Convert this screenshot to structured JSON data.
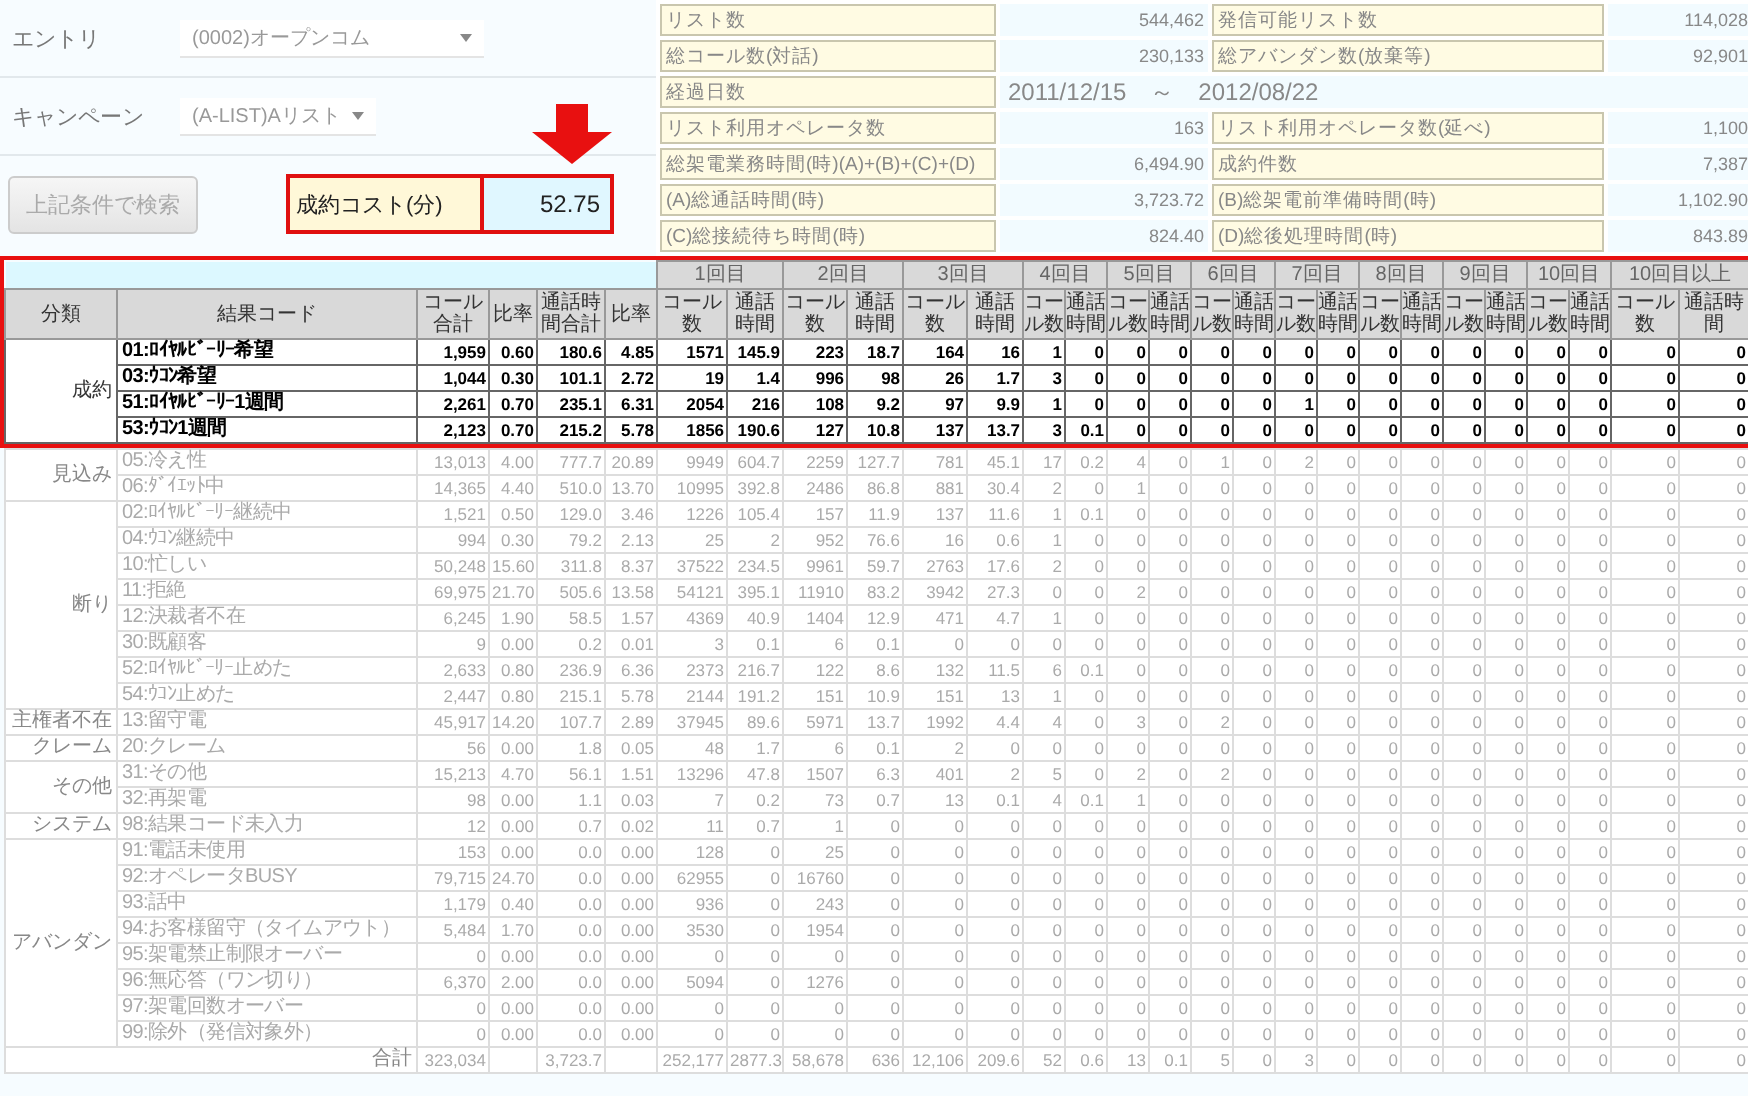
{
  "form": {
    "fields": [
      {
        "label": "エントリ",
        "value": "(0002)オープンコム"
      },
      {
        "label": "キャンペーン",
        "value": "(A-LIST)Aリスト"
      }
    ],
    "search_button": {
      "label": "上記条件で検索",
      "disabled": true
    }
  },
  "cost": {
    "label": "成約コスト(分)",
    "value": "52.75"
  },
  "stats": [
    {
      "cells": [
        {
          "label": "リスト数",
          "value": "544,462"
        },
        {
          "label": "発信可能リスト数",
          "value": "114,028"
        }
      ]
    },
    {
      "cells": [
        {
          "label": "総コール数(対話)",
          "value": "230,133"
        },
        {
          "label": "総アバンダン数(放棄等)",
          "value": "92,901"
        }
      ]
    },
    {
      "cells": [
        {
          "label": "経過日数",
          "value": "2011/12/15　～　2012/08/22"
        }
      ]
    },
    {
      "cells": [
        {
          "label": "リスト利用オペレータ数",
          "value": "163"
        },
        {
          "label": "リスト利用オペレータ数(延べ)",
          "value": "1,100"
        }
      ]
    },
    {
      "cells": [
        {
          "label": "総架電業務時間(時)(A)+(B)+(C)+(D)",
          "value": "6,494.90"
        },
        {
          "label": "成約件数",
          "value": "7,387"
        }
      ]
    },
    {
      "cells": [
        {
          "label": "(A)総通話時間(時)",
          "value": "3,723.72"
        },
        {
          "label": "(B)総架電前準備時間(時)",
          "value": "1,102.90"
        }
      ]
    },
    {
      "cells": [
        {
          "label": "(C)総接続待ち時間(時)",
          "value": "824.40"
        },
        {
          "label": "(D)総後処理時間(時)",
          "value": "843.89"
        }
      ]
    }
  ],
  "table": {
    "columns": [
      "分類",
      "結果コード",
      "コール合計",
      "比率",
      "通話時間合計",
      "比率"
    ],
    "rounds": [
      {
        "label": "1回目",
        "columns": [
          "コール数",
          "通話時間"
        ]
      },
      {
        "label": "2回目",
        "columns": [
          "コール数",
          "通話時間"
        ]
      },
      {
        "label": "3回目",
        "columns": [
          "コール数",
          "通話時間"
        ]
      },
      {
        "label": "4回目",
        "columns": [
          "コール数",
          "通話時間"
        ]
      },
      {
        "label": "5回目",
        "columns": [
          "コール数",
          "通話時間"
        ]
      },
      {
        "label": "6回目",
        "columns": [
          "コール数",
          "通話時間"
        ]
      },
      {
        "label": "7回目",
        "columns": [
          "コール数",
          "通話時間"
        ]
      },
      {
        "label": "8回目",
        "columns": [
          "コール数",
          "通話時間"
        ]
      },
      {
        "label": "9回目",
        "columns": [
          "コール数",
          "通話時間"
        ]
      },
      {
        "label": "10回目",
        "columns": [
          "コール数",
          "通話時間"
        ]
      },
      {
        "label": "10回目以上",
        "columns": [
          "コール数",
          "通話時間"
        ]
      }
    ],
    "groups": [
      {
        "label": "成約",
        "emphasized": true,
        "rows": [
          {
            "code": "01:ﾛｲﾔﾙﾋﾞｰﾘｰ希望",
            "cells": [
              "1,959",
              "0.60",
              "180.6",
              "4.85",
              "1571",
              "145.9",
              "223",
              "18.7",
              "164",
              "16",
              "1",
              "0",
              "0",
              "0",
              "0",
              "0",
              "0",
              "0",
              "0",
              "0",
              "0",
              "0",
              "0",
              "0",
              "0",
              "0"
            ]
          },
          {
            "code": "03:ｳｺﾝ希望",
            "cells": [
              "1,044",
              "0.30",
              "101.1",
              "2.72",
              "19",
              "1.4",
              "996",
              "98",
              "26",
              "1.7",
              "3",
              "0",
              "0",
              "0",
              "0",
              "0",
              "0",
              "0",
              "0",
              "0",
              "0",
              "0",
              "0",
              "0",
              "0",
              "0"
            ]
          },
          {
            "code": "51:ﾛｲﾔﾙﾋﾞｰﾘｰ1週間",
            "cells": [
              "2,261",
              "0.70",
              "235.1",
              "6.31",
              "2054",
              "216",
              "108",
              "9.2",
              "97",
              "9.9",
              "1",
              "0",
              "0",
              "0",
              "0",
              "0",
              "1",
              "0",
              "0",
              "0",
              "0",
              "0",
              "0",
              "0",
              "0",
              "0"
            ]
          },
          {
            "code": "53:ｳｺﾝ1週間",
            "cells": [
              "2,123",
              "0.70",
              "215.2",
              "5.78",
              "1856",
              "190.6",
              "127",
              "10.8",
              "137",
              "13.7",
              "3",
              "0.1",
              "0",
              "0",
              "0",
              "0",
              "0",
              "0",
              "0",
              "0",
              "0",
              "0",
              "0",
              "0",
              "0",
              "0"
            ]
          }
        ]
      },
      {
        "label": "見込み",
        "emphasized": false,
        "rows": [
          {
            "code": "05:冷え性",
            "cells": [
              "13,013",
              "4.00",
              "777.7",
              "20.89",
              "9949",
              "604.7",
              "2259",
              "127.7",
              "781",
              "45.1",
              "17",
              "0.2",
              "4",
              "0",
              "1",
              "0",
              "2",
              "0",
              "0",
              "0",
              "0",
              "0",
              "0",
              "0",
              "0",
              "0"
            ]
          },
          {
            "code": "06:ﾀﾞｲｴｯﾄ中",
            "cells": [
              "14,365",
              "4.40",
              "510.0",
              "13.70",
              "10995",
              "392.8",
              "2486",
              "86.8",
              "881",
              "30.4",
              "2",
              "0",
              "1",
              "0",
              "0",
              "0",
              "0",
              "0",
              "0",
              "0",
              "0",
              "0",
              "0",
              "0",
              "0",
              "0"
            ]
          }
        ]
      },
      {
        "label": "断り",
        "emphasized": false,
        "rows": [
          {
            "code": "02:ﾛｲﾔﾙﾋﾞｰﾘｰ継続中",
            "cells": [
              "1,521",
              "0.50",
              "129.0",
              "3.46",
              "1226",
              "105.4",
              "157",
              "11.9",
              "137",
              "11.6",
              "1",
              "0.1",
              "0",
              "0",
              "0",
              "0",
              "0",
              "0",
              "0",
              "0",
              "0",
              "0",
              "0",
              "0",
              "0",
              "0"
            ]
          },
          {
            "code": "04:ｳｺﾝ継続中",
            "cells": [
              "994",
              "0.30",
              "79.2",
              "2.13",
              "25",
              "2",
              "952",
              "76.6",
              "16",
              "0.6",
              "1",
              "0",
              "0",
              "0",
              "0",
              "0",
              "0",
              "0",
              "0",
              "0",
              "0",
              "0",
              "0",
              "0",
              "0",
              "0"
            ]
          },
          {
            "code": "10:忙しい",
            "cells": [
              "50,248",
              "15.60",
              "311.8",
              "8.37",
              "37522",
              "234.5",
              "9961",
              "59.7",
              "2763",
              "17.6",
              "2",
              "0",
              "0",
              "0",
              "0",
              "0",
              "0",
              "0",
              "0",
              "0",
              "0",
              "0",
              "0",
              "0",
              "0",
              "0"
            ]
          },
          {
            "code": "11:拒絶",
            "cells": [
              "69,975",
              "21.70",
              "505.6",
              "13.58",
              "54121",
              "395.1",
              "11910",
              "83.2",
              "3942",
              "27.3",
              "0",
              "0",
              "2",
              "0",
              "0",
              "0",
              "0",
              "0",
              "0",
              "0",
              "0",
              "0",
              "0",
              "0",
              "0",
              "0"
            ]
          },
          {
            "code": "12:決裁者不在",
            "cells": [
              "6,245",
              "1.90",
              "58.5",
              "1.57",
              "4369",
              "40.9",
              "1404",
              "12.9",
              "471",
              "4.7",
              "1",
              "0",
              "0",
              "0",
              "0",
              "0",
              "0",
              "0",
              "0",
              "0",
              "0",
              "0",
              "0",
              "0",
              "0",
              "0"
            ]
          },
          {
            "code": "30:既顧客",
            "cells": [
              "9",
              "0.00",
              "0.2",
              "0.01",
              "3",
              "0.1",
              "6",
              "0.1",
              "0",
              "0",
              "0",
              "0",
              "0",
              "0",
              "0",
              "0",
              "0",
              "0",
              "0",
              "0",
              "0",
              "0",
              "0",
              "0",
              "0",
              "0"
            ]
          },
          {
            "code": "52:ﾛｲﾔﾙﾋﾞｰﾘｰ止めた",
            "cells": [
              "2,633",
              "0.80",
              "236.9",
              "6.36",
              "2373",
              "216.7",
              "122",
              "8.6",
              "132",
              "11.5",
              "6",
              "0.1",
              "0",
              "0",
              "0",
              "0",
              "0",
              "0",
              "0",
              "0",
              "0",
              "0",
              "0",
              "0",
              "0",
              "0"
            ]
          },
          {
            "code": "54:ｳｺﾝ止めた",
            "cells": [
              "2,447",
              "0.80",
              "215.1",
              "5.78",
              "2144",
              "191.2",
              "151",
              "10.9",
              "151",
              "13",
              "1",
              "0",
              "0",
              "0",
              "0",
              "0",
              "0",
              "0",
              "0",
              "0",
              "0",
              "0",
              "0",
              "0",
              "0",
              "0"
            ]
          }
        ]
      },
      {
        "label": "主権者不在",
        "emphasized": false,
        "rows": [
          {
            "code": "13:留守電",
            "cells": [
              "45,917",
              "14.20",
              "107.7",
              "2.89",
              "37945",
              "89.6",
              "5971",
              "13.7",
              "1992",
              "4.4",
              "4",
              "0",
              "3",
              "0",
              "2",
              "0",
              "0",
              "0",
              "0",
              "0",
              "0",
              "0",
              "0",
              "0",
              "0",
              "0"
            ]
          }
        ]
      },
      {
        "label": "クレーム",
        "emphasized": false,
        "rows": [
          {
            "code": "20:クレーム",
            "cells": [
              "56",
              "0.00",
              "1.8",
              "0.05",
              "48",
              "1.7",
              "6",
              "0.1",
              "2",
              "0",
              "0",
              "0",
              "0",
              "0",
              "0",
              "0",
              "0",
              "0",
              "0",
              "0",
              "0",
              "0",
              "0",
              "0",
              "0",
              "0"
            ]
          }
        ]
      },
      {
        "label": "その他",
        "emphasized": false,
        "rows": [
          {
            "code": "31:その他",
            "cells": [
              "15,213",
              "4.70",
              "56.1",
              "1.51",
              "13296",
              "47.8",
              "1507",
              "6.3",
              "401",
              "2",
              "5",
              "0",
              "2",
              "0",
              "2",
              "0",
              "0",
              "0",
              "0",
              "0",
              "0",
              "0",
              "0",
              "0",
              "0",
              "0"
            ]
          },
          {
            "code": "32:再架電",
            "cells": [
              "98",
              "0.00",
              "1.1",
              "0.03",
              "7",
              "0.2",
              "73",
              "0.7",
              "13",
              "0.1",
              "4",
              "0.1",
              "1",
              "0",
              "0",
              "0",
              "0",
              "0",
              "0",
              "0",
              "0",
              "0",
              "0",
              "0",
              "0",
              "0"
            ]
          }
        ]
      },
      {
        "label": "システム",
        "emphasized": false,
        "rows": [
          {
            "code": "98:結果コード未入力",
            "cells": [
              "12",
              "0.00",
              "0.7",
              "0.02",
              "11",
              "0.7",
              "1",
              "0",
              "0",
              "0",
              "0",
              "0",
              "0",
              "0",
              "0",
              "0",
              "0",
              "0",
              "0",
              "0",
              "0",
              "0",
              "0",
              "0",
              "0",
              "0"
            ]
          }
        ]
      },
      {
        "label": "アバンダン",
        "emphasized": false,
        "rows": [
          {
            "code": "91:電話未使用",
            "cells": [
              "153",
              "0.00",
              "0.0",
              "0.00",
              "128",
              "0",
              "25",
              "0",
              "0",
              "0",
              "0",
              "0",
              "0",
              "0",
              "0",
              "0",
              "0",
              "0",
              "0",
              "0",
              "0",
              "0",
              "0",
              "0",
              "0",
              "0"
            ]
          },
          {
            "code": "92:オペレータBUSY",
            "cells": [
              "79,715",
              "24.70",
              "0.0",
              "0.00",
              "62955",
              "0",
              "16760",
              "0",
              "0",
              "0",
              "0",
              "0",
              "0",
              "0",
              "0",
              "0",
              "0",
              "0",
              "0",
              "0",
              "0",
              "0",
              "0",
              "0",
              "0",
              "0"
            ]
          },
          {
            "code": "93:話中",
            "cells": [
              "1,179",
              "0.40",
              "0.0",
              "0.00",
              "936",
              "0",
              "243",
              "0",
              "0",
              "0",
              "0",
              "0",
              "0",
              "0",
              "0",
              "0",
              "0",
              "0",
              "0",
              "0",
              "0",
              "0",
              "0",
              "0",
              "0",
              "0"
            ]
          },
          {
            "code": "94:お客様留守（タイムアウト）",
            "cells": [
              "5,484",
              "1.70",
              "0.0",
              "0.00",
              "3530",
              "0",
              "1954",
              "0",
              "0",
              "0",
              "0",
              "0",
              "0",
              "0",
              "0",
              "0",
              "0",
              "0",
              "0",
              "0",
              "0",
              "0",
              "0",
              "0",
              "0",
              "0"
            ]
          },
          {
            "code": "95:架電禁止制限オーバー",
            "cells": [
              "0",
              "0.00",
              "0.0",
              "0.00",
              "0",
              "0",
              "0",
              "0",
              "0",
              "0",
              "0",
              "0",
              "0",
              "0",
              "0",
              "0",
              "0",
              "0",
              "0",
              "0",
              "0",
              "0",
              "0",
              "0",
              "0",
              "0"
            ]
          },
          {
            "code": "96:無応答（ワン切り）",
            "cells": [
              "6,370",
              "2.00",
              "0.0",
              "0.00",
              "5094",
              "0",
              "1276",
              "0",
              "0",
              "0",
              "0",
              "0",
              "0",
              "0",
              "0",
              "0",
              "0",
              "0",
              "0",
              "0",
              "0",
              "0",
              "0",
              "0",
              "0",
              "0"
            ]
          },
          {
            "code": "97:架電回数オーバー",
            "cells": [
              "0",
              "0.00",
              "0.0",
              "0.00",
              "0",
              "0",
              "0",
              "0",
              "0",
              "0",
              "0",
              "0",
              "0",
              "0",
              "0",
              "0",
              "0",
              "0",
              "0",
              "0",
              "0",
              "0",
              "0",
              "0",
              "0",
              "0"
            ]
          },
          {
            "code": "99:除外（発信対象外）",
            "cells": [
              "0",
              "0.00",
              "0.0",
              "0.00",
              "0",
              "0",
              "0",
              "0",
              "0",
              "0",
              "0",
              "0",
              "0",
              "0",
              "0",
              "0",
              "0",
              "0",
              "0",
              "0",
              "0",
              "0",
              "0",
              "0",
              "0",
              "0"
            ]
          }
        ]
      }
    ],
    "total": {
      "label": "合計",
      "cells": [
        "323,034",
        "",
        "3,723.7",
        "",
        "252,177",
        "2877.3",
        "58,678",
        "636",
        "12,106",
        "209.6",
        "52",
        "0.6",
        "13",
        "0.1",
        "5",
        "0",
        "3",
        "0",
        "0",
        "0",
        "0",
        "0",
        "0",
        "0",
        "0",
        "0"
      ]
    }
  }
}
